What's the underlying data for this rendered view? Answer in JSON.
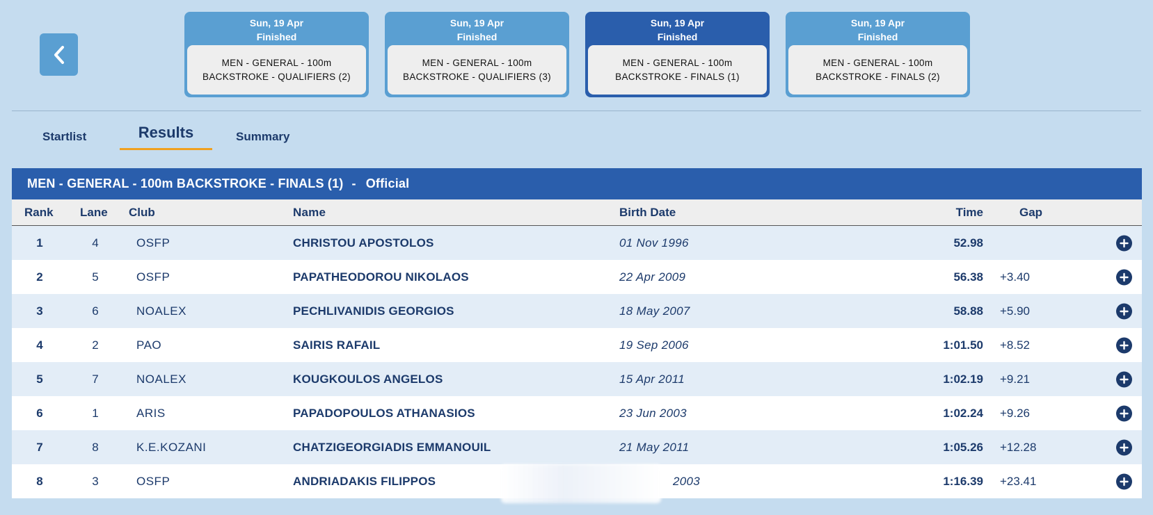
{
  "back_button": {
    "icon": "chevron-left-icon"
  },
  "event_cards": [
    {
      "date": "Sun, 19 Apr",
      "status": "Finished",
      "line1": "MEN - GENERAL - 100m",
      "line2": "BACKSTROKE - QUALIFIERS (2)",
      "active": false
    },
    {
      "date": "Sun, 19 Apr",
      "status": "Finished",
      "line1": "MEN - GENERAL - 100m",
      "line2": "BACKSTROKE - QUALIFIERS (3)",
      "active": false
    },
    {
      "date": "Sun, 19 Apr",
      "status": "Finished",
      "line1": "MEN - GENERAL - 100m",
      "line2": "BACKSTROKE - FINALS (1)",
      "active": true
    },
    {
      "date": "Sun, 19 Apr",
      "status": "Finished",
      "line1": "MEN - GENERAL - 100m",
      "line2": "BACKSTROKE - FINALS (2)",
      "active": false
    }
  ],
  "tabs": {
    "startlist": "Startlist",
    "results": "Results",
    "summary": "Summary",
    "active": "Results"
  },
  "results": {
    "title": "MEN - GENERAL - 100m BACKSTROKE - FINALS (1)",
    "separator": "-",
    "status": "Official",
    "columns": {
      "rank": "Rank",
      "lane": "Lane",
      "club": "Club",
      "name": "Name",
      "birth_date": "Birth Date",
      "time": "Time",
      "gap": "Gap"
    },
    "rows": [
      {
        "rank": "1",
        "lane": "4",
        "club": "OSFP",
        "name": "CHRISTOU APOSTOLOS",
        "birth_date": "01 Nov 1996",
        "time": "52.98",
        "gap": ""
      },
      {
        "rank": "2",
        "lane": "5",
        "club": "OSFP",
        "name": "PAPATHEODOROU NIKOLAOS",
        "birth_date": "22 Apr 2009",
        "time": "56.38",
        "gap": "+3.40"
      },
      {
        "rank": "3",
        "lane": "6",
        "club": "NOALEX",
        "name": "PECHLIVANIDIS GEORGIOS",
        "birth_date": "18 May 2007",
        "time": "58.88",
        "gap": "+5.90"
      },
      {
        "rank": "4",
        "lane": "2",
        "club": "PAO",
        "name": "SAIRIS RAFAIL",
        "birth_date": "19 Sep 2006",
        "time": "1:01.50",
        "gap": "+8.52"
      },
      {
        "rank": "5",
        "lane": "7",
        "club": "NOALEX",
        "name": "KOUGKOULOS ANGELOS",
        "birth_date": "15 Apr 2011",
        "time": "1:02.19",
        "gap": "+9.21"
      },
      {
        "rank": "6",
        "lane": "1",
        "club": "ARIS",
        "name": "PAPADOPOULOS ATHANASIOS",
        "birth_date": "23 Jun 2003",
        "time": "1:02.24",
        "gap": "+9.26"
      },
      {
        "rank": "7",
        "lane": "8",
        "club": "K.E.KOZANI",
        "name": "CHATZIGEORGIADIS EMMANOUIL",
        "birth_date": "21 May 2011",
        "time": "1:05.26",
        "gap": "+12.28"
      },
      {
        "rank": "8",
        "lane": "3",
        "club": "OSFP",
        "name": "ANDRIADAKIS FILIPPOS",
        "birth_date": "2003",
        "time": "1:16.39",
        "gap": "+23.41"
      }
    ],
    "row_action_icon": "plus-circle-icon"
  },
  "colors": {
    "background": "#c5dcef",
    "card": "#5a9fd2",
    "card_active": "#2a5eac",
    "title_bar": "#2a5eac",
    "text": "#1c3a6b",
    "tab_underline": "#f0a020"
  }
}
